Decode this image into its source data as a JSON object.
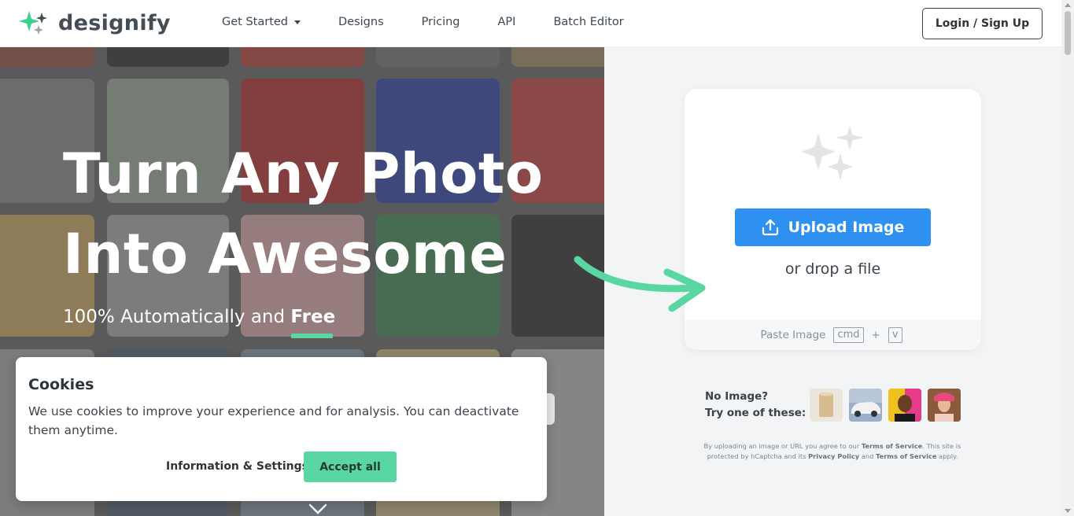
{
  "header": {
    "logo_text": "designify",
    "nav": [
      {
        "label": "Get Started",
        "has_caret": true
      },
      {
        "label": "Designs"
      },
      {
        "label": "Pricing"
      },
      {
        "label": "API"
      },
      {
        "label": "Batch Editor"
      }
    ],
    "login_label": "Login / Sign Up"
  },
  "hero": {
    "title_line1": "Turn Any Photo",
    "title_line2": "Into Awesome",
    "subtitle_prefix": "100% Automatically and ",
    "subtitle_emphasis": "Free"
  },
  "upload": {
    "button_label": "Upload Image",
    "drop_text": "or drop a file",
    "paste_label": "Paste Image",
    "key_cmd": "cmd",
    "key_plus": "+",
    "key_v": "v"
  },
  "samples": {
    "line1": "No Image?",
    "line2": "Try one of these:",
    "items": [
      "cup-sample",
      "car-sample",
      "man-sample",
      "woman-sample"
    ]
  },
  "terms": {
    "p1": "By uploading an image or URL you agree to our ",
    "tos1": "Terms of Service",
    "p2": ". This site is protected by hCaptcha and its ",
    "privacy": "Privacy Policy",
    "p3": " and ",
    "tos2": "Terms of Service",
    "p4": " apply."
  },
  "cookies": {
    "title": "Cookies",
    "text": "We use cookies to improve your experience and for analysis. You can deactivate them anytime.",
    "info_label": "Information & Settings",
    "accept_label": "Accept all"
  },
  "colors": {
    "accent_green": "#5ad6a3",
    "upload_blue": "#2e90f0",
    "text_dark": "#3e4852"
  }
}
